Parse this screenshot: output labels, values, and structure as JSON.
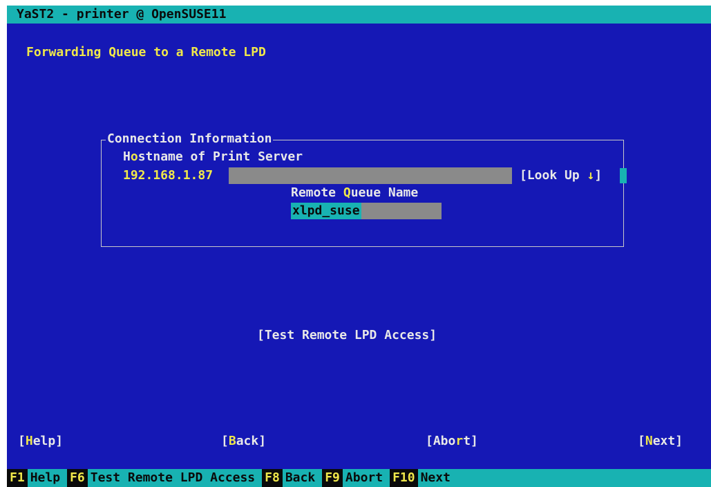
{
  "window": {
    "title": "YaST2 - printer @ OpenSUSE11"
  },
  "dialog": {
    "heading": "Forwarding Queue to a Remote LPD",
    "frame_title": "Connection Information",
    "hostname": {
      "label_pre": "H",
      "label_hot": "o",
      "label_post": "stname of Print Server",
      "value": "192.168.1.87",
      "lookup_label": "[Look Up",
      "lookup_arrow": "↓",
      "lookup_close": "]"
    },
    "queue": {
      "label_pre": "Remote ",
      "label_hot": "Q",
      "label_post": "ueue Name",
      "value": "xlpd_suse"
    },
    "test_button": "[Test Remote LPD Access]"
  },
  "buttons": {
    "help": {
      "pre": "[",
      "hot": "H",
      "post": "elp]"
    },
    "back": {
      "pre": "[",
      "hot": "B",
      "post": "ack]"
    },
    "abort": {
      "pre": "[Abo",
      "hot": "r",
      "post": "t]"
    },
    "next": {
      "pre": "[",
      "hot": "N",
      "post": "ext]"
    }
  },
  "fkeys": [
    {
      "key": "F1",
      "label": "Help"
    },
    {
      "key": "F6",
      "label": "Test Remote LPD Access"
    },
    {
      "key": "F8",
      "label": "Back"
    },
    {
      "key": "F9",
      "label": "Abort"
    },
    {
      "key": "F10",
      "label": "Next"
    }
  ],
  "colors": {
    "background": "#1518b5",
    "bar": "#18b2b2",
    "hotkey": "#f0e84a",
    "field": "#8a8a8a"
  }
}
